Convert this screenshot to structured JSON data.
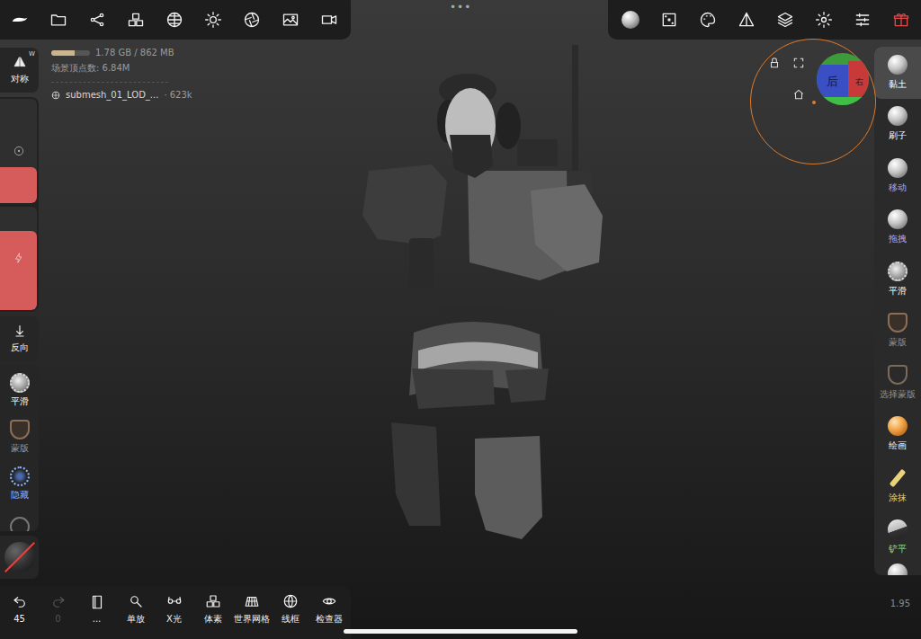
{
  "menu_dots": "•••",
  "memory": {
    "text": "1.78 GB / 862 MB",
    "level": 0.6
  },
  "scene_vertices": "场景顶点数: 6.84M",
  "mesh": {
    "name": "submesh_01_LOD_...",
    "count": "· 623k"
  },
  "symmetry": {
    "label": "对称",
    "badge": "W"
  },
  "sliders": [
    {
      "name": "radius",
      "level": 0.34
    },
    {
      "name": "intensity",
      "level": 0.76
    }
  ],
  "invert": {
    "label": "反向"
  },
  "left_tools": [
    {
      "label": "平滑",
      "color": "#ffffff"
    },
    {
      "label": "蒙版",
      "color": "#9a9a9a"
    },
    {
      "label": "隐藏",
      "color": "#8fb4ff"
    }
  ],
  "right_tools": [
    {
      "label": "黏土",
      "selected": true,
      "color": "#ffffff"
    },
    {
      "label": "刷子",
      "selected": false,
      "color": "#ffffff"
    },
    {
      "label": "移动",
      "selected": false,
      "color": "#b4a7f5"
    },
    {
      "label": "拖拽",
      "selected": false,
      "color": "#b4a7f5"
    },
    {
      "label": "平滑",
      "selected": false,
      "color": "#ffffff"
    },
    {
      "label": "蒙版",
      "selected": false,
      "color": "#9a8e84"
    },
    {
      "label": "选择蒙版",
      "selected": false,
      "color": "#9a8e84"
    },
    {
      "label": "绘画",
      "selected": false,
      "color": "#ffffff"
    },
    {
      "label": "涂抹",
      "selected": false,
      "color": "#e8d27a"
    },
    {
      "label": "铲平",
      "selected": false,
      "color": "#9fdc8f"
    }
  ],
  "bottom_tools": [
    {
      "label": "45",
      "disabled": false
    },
    {
      "label": "0",
      "disabled": true
    },
    {
      "label": "...",
      "disabled": false
    },
    {
      "label": "单放",
      "disabled": false
    },
    {
      "label": "X光",
      "disabled": false
    },
    {
      "label": "体素",
      "disabled": false
    },
    {
      "label": "世界网格",
      "disabled": false
    },
    {
      "label": "线框",
      "disabled": false
    },
    {
      "label": "检查器",
      "disabled": false
    }
  ],
  "gizmo": {
    "faces": [
      "后",
      "右"
    ]
  },
  "zoom": "1.95"
}
